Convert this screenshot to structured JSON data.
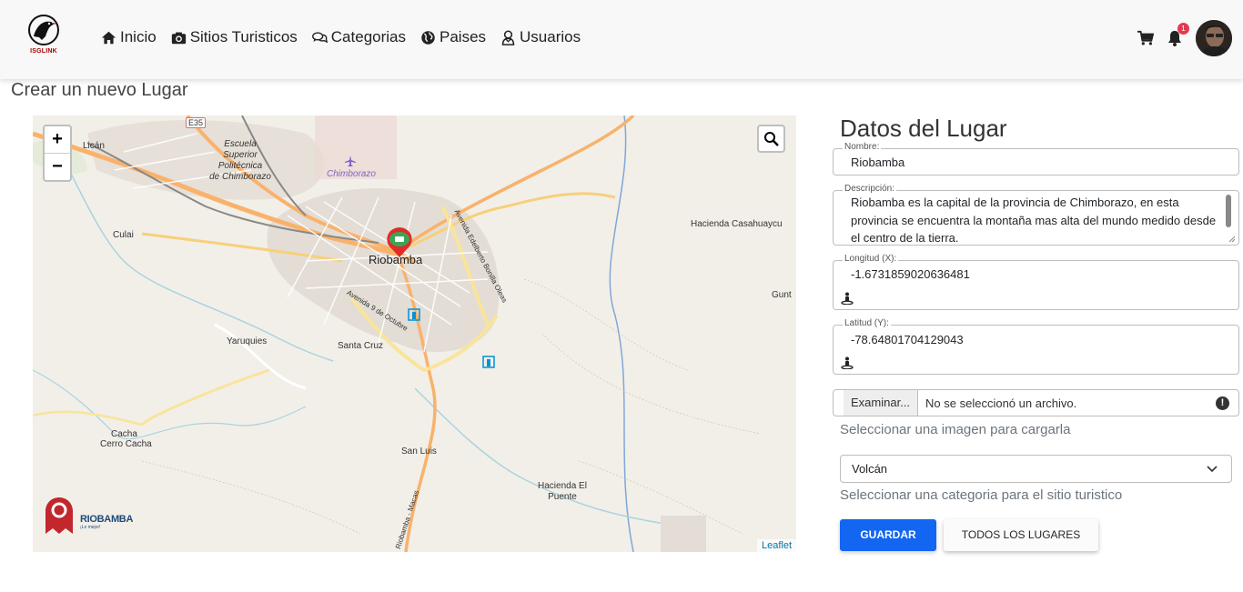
{
  "brand": {
    "name": "ISGLINK"
  },
  "nav": {
    "items": [
      {
        "label": "Inicio",
        "icon": "home-icon"
      },
      {
        "label": "Sitios Turisticos",
        "icon": "camera-icon"
      },
      {
        "label": "Categorias",
        "icon": "comments-icon"
      },
      {
        "label": "Paises",
        "icon": "globe-icon"
      },
      {
        "label": "Usuarios",
        "icon": "user-icon"
      }
    ],
    "notification_count": "1"
  },
  "page": {
    "title": "Crear un nuevo Lugar"
  },
  "map": {
    "zoom_in": "+",
    "zoom_out": "−",
    "attribution": "Leaflet",
    "marker_label": "Riobamba",
    "labels": {
      "lican": "Licán",
      "escuela": "Escuela\nSuperior\nPolitécnica\nde Chimborazo",
      "chimborazo": "Chimborazo",
      "culai": "Culai",
      "hacienda_casahuaycu": "Hacienda Casahuaycu",
      "gunt": "Gunt",
      "yaruquies": "Yaruquies",
      "santa_cruz": "Santa Cruz",
      "cacha": "Cacha",
      "cerro_cacha": "Cerro Cacha",
      "san_luis": "San Luis",
      "hacienda_el_puente": "Hacienda El\nPuente",
      "e35": "E35",
      "av_9_octubre": "Avenida 9 de Octubre",
      "av_bonilla": "Avenida Edelberto Bonilla Oleas",
      "av_riobamba": "Riobamba - Macas"
    },
    "logo_text": "RIOBAMBA",
    "logo_sub": "¡Lo mejor!"
  },
  "form": {
    "title": "Datos del Lugar",
    "nombre": {
      "label": "Nombre:",
      "value": "Riobamba"
    },
    "descripcion": {
      "label": "Descripción:",
      "value": "Riobamba es la capital de la provincia de Chimborazo, en esta provincia se encuentra la montaña mas alta del mundo medido desde el centro de la tierra."
    },
    "longitud": {
      "label": "Longitud (X):",
      "value": "-1.6731859020636481"
    },
    "latitud": {
      "label": "Latitud (Y):",
      "value": "-78.64801704129043"
    },
    "file": {
      "button": "Examinar...",
      "status": "No se seleccionó un archivo."
    },
    "file_help": "Seleccionar una imagen para cargarla",
    "categoria": {
      "value": "Volcán"
    },
    "categoria_help": "Seleccionar una categoria para el sitio turistico",
    "save": "GUARDAR",
    "all": "TODOS LOS LUGARES"
  }
}
